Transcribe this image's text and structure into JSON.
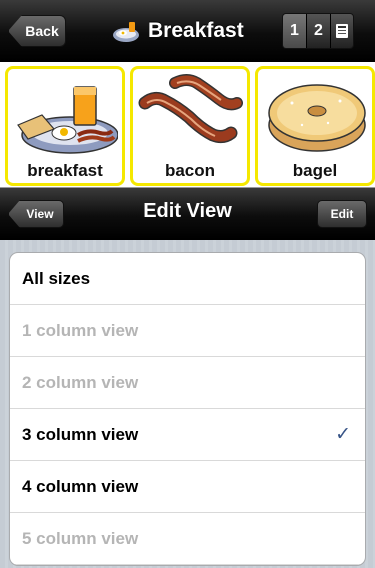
{
  "header": {
    "back_label": "Back",
    "title": "Breakfast",
    "segments": [
      "1",
      "2"
    ],
    "segment_icon": "book-icon"
  },
  "tiles": [
    {
      "label": "breakfast",
      "icon": "breakfast-plate-icon"
    },
    {
      "label": "bacon",
      "icon": "bacon-icon"
    },
    {
      "label": "bagel",
      "icon": "bagel-icon"
    }
  ],
  "editbar": {
    "view_label": "View",
    "title": "Edit View",
    "edit_label": "Edit"
  },
  "options": [
    {
      "label": "All sizes",
      "enabled": true,
      "checked": false
    },
    {
      "label": "1 column view",
      "enabled": false,
      "checked": false
    },
    {
      "label": "2 column view",
      "enabled": false,
      "checked": false
    },
    {
      "label": "3 column view",
      "enabled": true,
      "checked": true
    },
    {
      "label": "4 column view",
      "enabled": true,
      "checked": false
    },
    {
      "label": "5 column view",
      "enabled": false,
      "checked": false
    }
  ],
  "colors": {
    "tile_border": "#f5e800",
    "checkmark": "#385487",
    "disabled_text": "#b5b5b5"
  },
  "check_glyph": "✓"
}
